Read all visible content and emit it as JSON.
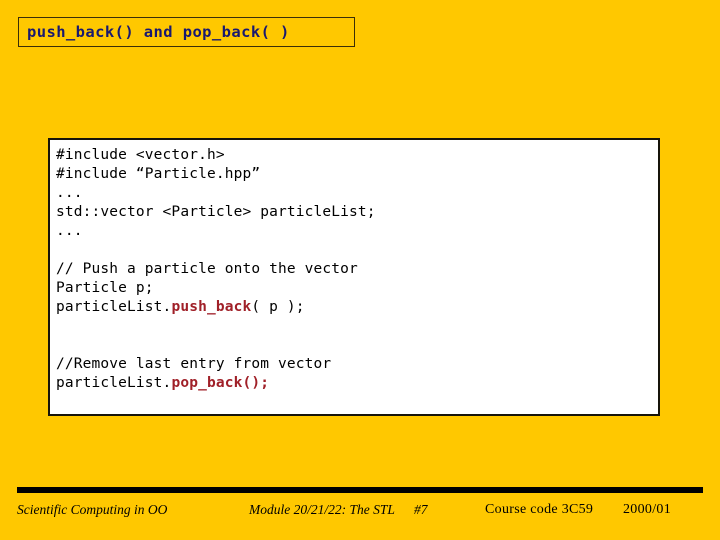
{
  "slide": {
    "title": "push_back() and pop_back( )",
    "background_color": "#FFC800",
    "title_color": "#191970",
    "highlight_color": "#A02028"
  },
  "code_block": {
    "lines": [
      {
        "text": "#include <vector.h>",
        "highlight": null
      },
      {
        "text": "#include “Particle.hpp”",
        "highlight": null
      },
      {
        "text": "...",
        "highlight": null
      },
      {
        "text": "std::vector <Particle> particleList;",
        "highlight": null
      },
      {
        "text": "...",
        "highlight": null
      },
      {
        "text": "",
        "highlight": null
      },
      {
        "text": "// Push a particle onto the vector",
        "highlight": null
      },
      {
        "text": "Particle p;",
        "highlight": null
      },
      {
        "prefix": "particleList.",
        "highlight": "push_back",
        "suffix": "( p );"
      },
      {
        "text": "",
        "highlight": null
      },
      {
        "text": "",
        "highlight": null
      },
      {
        "text": "//Remove last entry from vector",
        "highlight": null
      },
      {
        "prefix": "particleList.",
        "highlight": "pop_back();",
        "suffix": ""
      }
    ]
  },
  "footer": {
    "left": "Scientific Computing in OO",
    "module": "Module 20/21/22: The STL",
    "page": "#7",
    "course": "Course code 3C59",
    "year": "2000/01"
  }
}
